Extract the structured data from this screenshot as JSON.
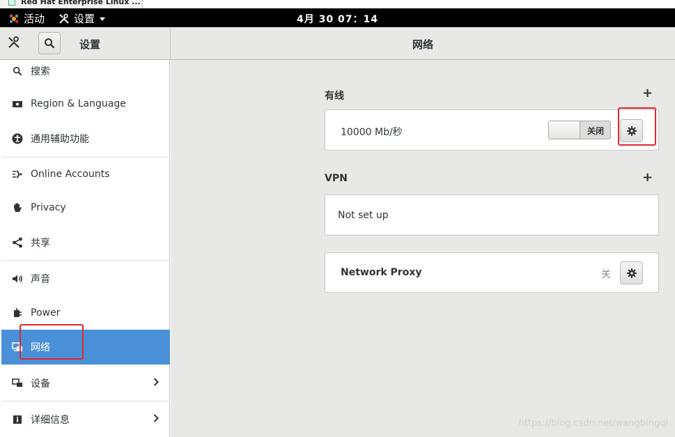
{
  "window_tab": {
    "title": "Red Hat Enterprise Linux ..."
  },
  "topbar": {
    "activities": "活动",
    "app_menu": "设置",
    "clock": "4月 30 07：14"
  },
  "headerbar": {
    "left_title": "设置",
    "main_title": "网络"
  },
  "sidebar": {
    "items": [
      {
        "label": "搜索",
        "icon": "search-icon"
      },
      {
        "label": "Region & Language",
        "icon": "flag-icon"
      },
      {
        "label": "通用辅助功能",
        "icon": "accessibility-icon"
      },
      {
        "label": "Online Accounts",
        "icon": "online-accounts-icon"
      },
      {
        "label": "Privacy",
        "icon": "hand-icon"
      },
      {
        "label": "共享",
        "icon": "share-icon"
      },
      {
        "label": "声音",
        "icon": "speaker-icon"
      },
      {
        "label": "Power",
        "icon": "power-plug-icon"
      },
      {
        "label": "网络",
        "icon": "network-icon",
        "selected": true
      },
      {
        "label": "设备",
        "icon": "devices-icon",
        "has_chevron": true
      },
      {
        "label": "详细信息",
        "icon": "info-icon",
        "has_chevron": true
      }
    ]
  },
  "wired": {
    "title": "有线",
    "speed": "10000 Mb/秒",
    "switch_label": "关闭"
  },
  "vpn": {
    "title": "VPN",
    "status": "Not set up"
  },
  "proxy": {
    "label": "Network Proxy",
    "status": "关"
  },
  "watermark": "https://blog.csdn.net/wangbingqi",
  "colors": {
    "selected": "#4a90d9",
    "highlight": "#e3262b"
  }
}
